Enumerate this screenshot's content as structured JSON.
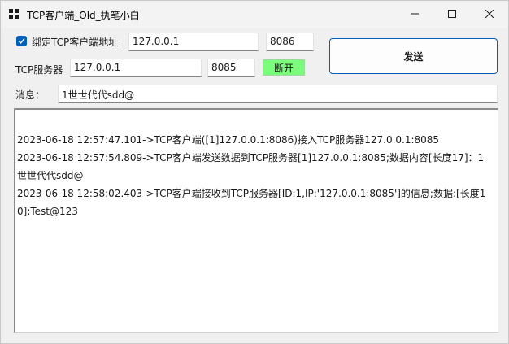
{
  "window": {
    "title": "TCP客户端_Old_执笔小白",
    "icons": {
      "app": "app-grid-icon",
      "minimize": "minimize-icon",
      "maximize": "maximize-icon",
      "close": "close-icon"
    }
  },
  "client": {
    "bind_checkbox_checked": true,
    "bind_label": "绑定TCP客户端地址",
    "ip": "127.0.0.1",
    "port": "8086"
  },
  "server": {
    "label": "TCP服务器",
    "ip": "127.0.0.1",
    "port": "8085",
    "disconnect_label": "断开"
  },
  "send": {
    "label": "发送"
  },
  "message": {
    "label": "消息：",
    "value": "1世世代代sdd@"
  },
  "log": [
    "2023-06-18 12:57:47.101->TCP客户端([1]127.0.0.1:8086)接入TCP服务器127.0.0.1:8085",
    "2023-06-18 12:57:54.809->TCP客户端发送数据到TCP服务器[1]127.0.0.1:8085;数据内容[长度17]：1世世代代sdd@",
    "2023-06-18 12:58:02.403->TCP客户端接收到TCP服务器[ID:1,IP:'127.0.0.1:8085']的信息;数据:[长度10]:Test@123"
  ],
  "colors": {
    "accent": "#005fb8",
    "disconnect_bg": "#7cfc7c"
  }
}
